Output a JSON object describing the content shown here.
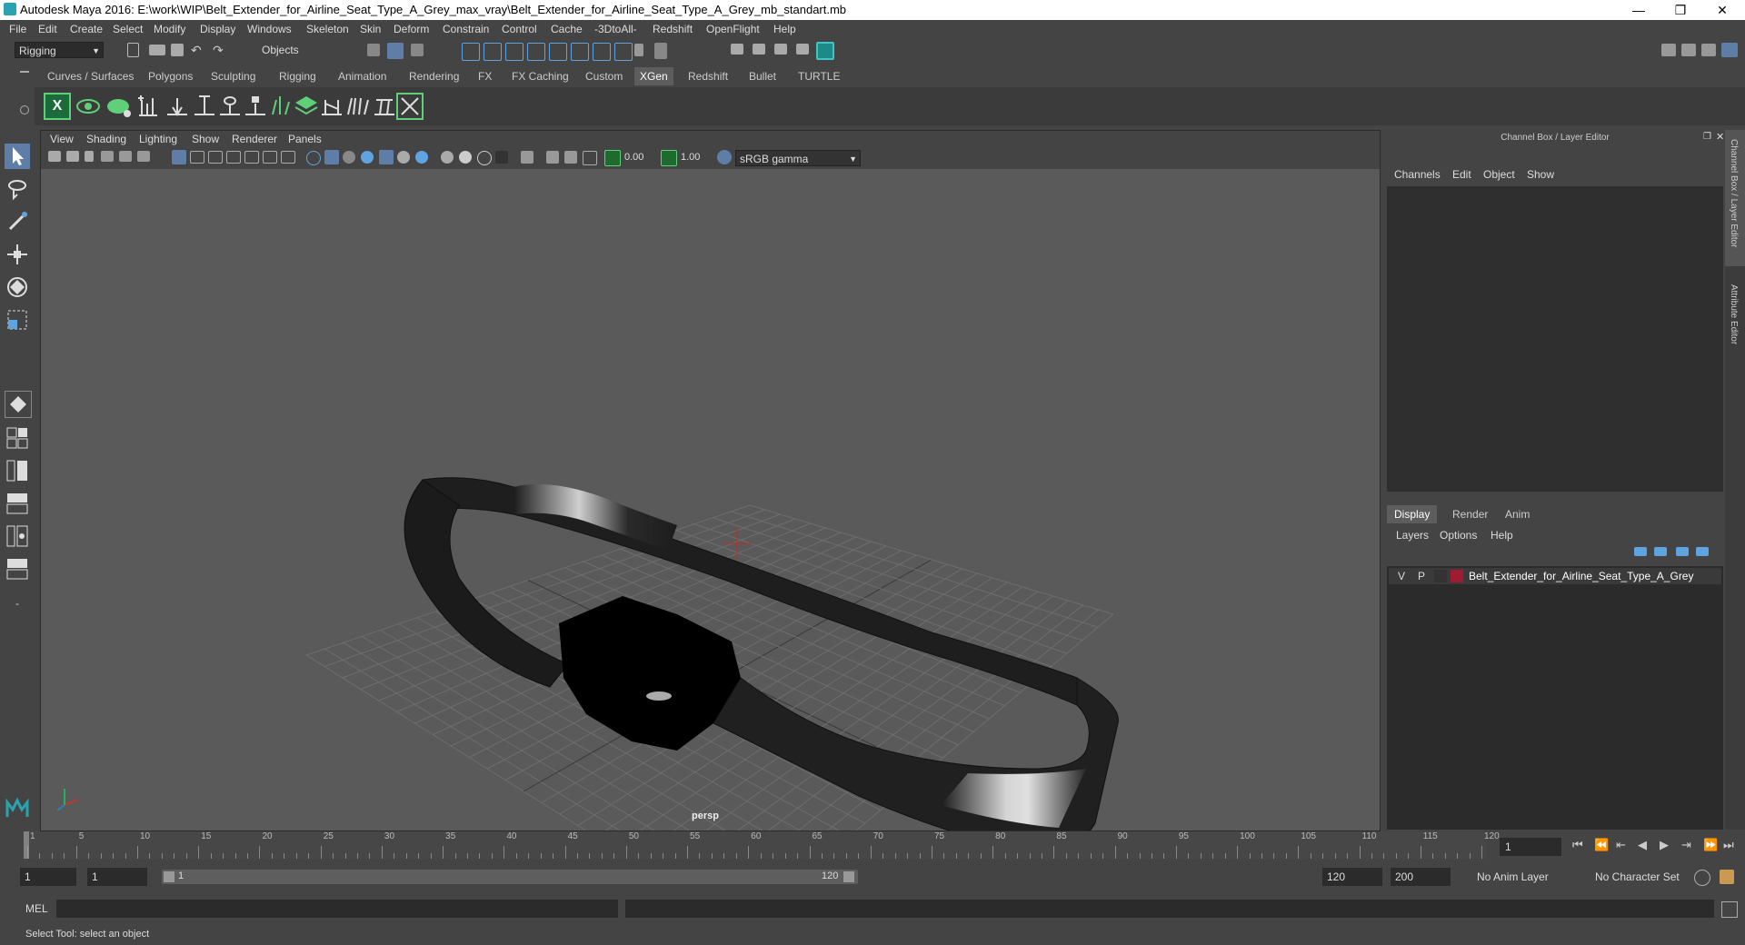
{
  "window": {
    "title": "Autodesk Maya 2016: E:\\work\\WIP\\Belt_Extender_for_Airline_Seat_Type_A_Grey_max_vray\\Belt_Extender_for_Airline_Seat_Type_A_Grey_mb_standart.mb",
    "minimize": "—",
    "restore": "❐",
    "close": "✕"
  },
  "menubar": [
    "File",
    "Edit",
    "Create",
    "Select",
    "Modify",
    "Display",
    "Windows",
    "Skeleton",
    "Skin",
    "Deform",
    "Constrain",
    "Control",
    "Cache",
    "-3DtoAll-",
    "Redshift",
    "OpenFlight",
    "Help"
  ],
  "toolbar": {
    "menuset": "Rigging",
    "selection_mode": "Objects"
  },
  "shelf": {
    "tabs": [
      "Curves / Surfaces",
      "Polygons",
      "Sculpting",
      "Rigging",
      "Animation",
      "Rendering",
      "FX",
      "FX Caching",
      "Custom",
      "XGen",
      "Redshift",
      "Bullet",
      "TURTLE"
    ],
    "active_tab": "XGen"
  },
  "viewport": {
    "menus": [
      "View",
      "Shading",
      "Lighting",
      "Show",
      "Renderer",
      "Panels"
    ],
    "exposure": "0.00",
    "gamma": "1.00",
    "color_space": "sRGB gamma",
    "camera_label": "persp"
  },
  "channel_box": {
    "title": "Channel Box / Layer Editor",
    "menus": [
      "Channels",
      "Edit",
      "Object",
      "Show"
    ],
    "layer_tabs": [
      "Display",
      "Render",
      "Anim"
    ],
    "active_layer_tab": "Display",
    "layer_menus": [
      "Layers",
      "Options",
      "Help"
    ],
    "layers": [
      {
        "v": "V",
        "p": "P",
        "name": "Belt_Extender_for_Airline_Seat_Type_A_Grey",
        "color": "#9e1b32"
      }
    ]
  },
  "side_tabs": [
    "Channel Box / Layer Editor",
    "Attribute Editor"
  ],
  "time_slider": {
    "ticks": [
      "1",
      "5",
      "10",
      "15",
      "20",
      "25",
      "30",
      "35",
      "40",
      "45",
      "50",
      "55",
      "60",
      "65",
      "70",
      "75",
      "80",
      "85",
      "90",
      "95",
      "100",
      "105",
      "110",
      "115",
      "120"
    ],
    "current_frame": "1"
  },
  "range": {
    "start": "1",
    "playback_start": "1",
    "range_start_label": "1",
    "range_end_label": "120",
    "playback_end": "120",
    "end": "200",
    "anim_layer": "No Anim Layer",
    "character_set": "No Character Set"
  },
  "command_line": {
    "lang": "MEL"
  },
  "help_line": "Select Tool: select an object"
}
